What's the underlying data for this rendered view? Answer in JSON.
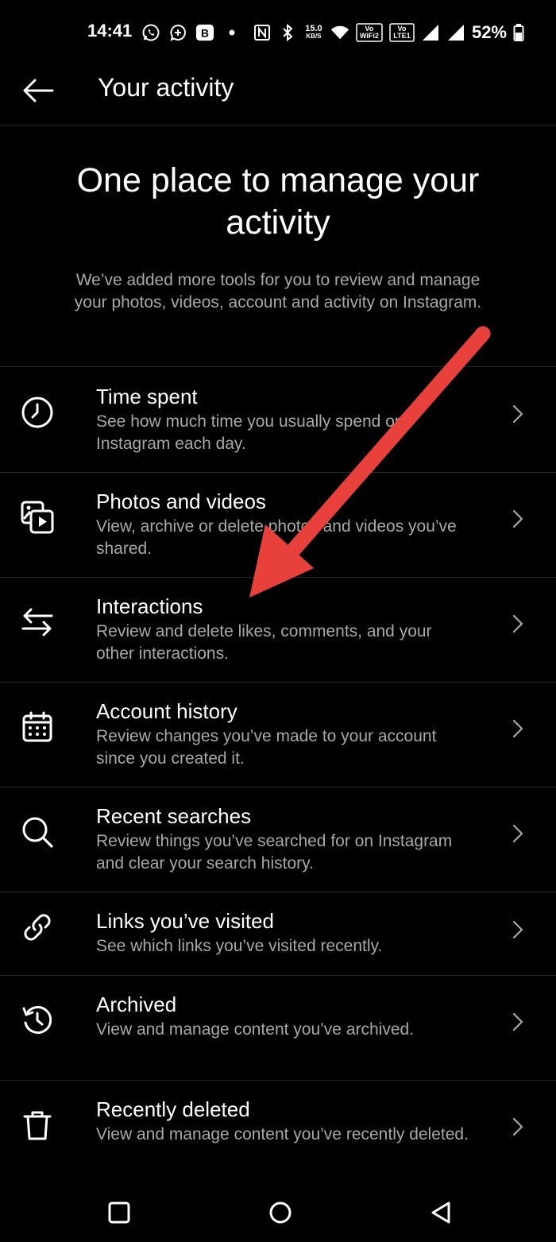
{
  "status_bar": {
    "time": "14:41",
    "speed_top": "15.0",
    "speed_unit": "KB/S",
    "sim1_top": "Vo",
    "sim1_bottom": "WiFi2",
    "sim2_top": "Vo",
    "sim2_bottom": "LTE1",
    "battery": "52%",
    "b_badge": "B",
    "icons": [
      "whatsapp-icon",
      "messenger-icon",
      "b-app-icon",
      "dot-icon",
      "nfc-icon",
      "bluetooth-icon",
      "wifi-icon",
      "signal-icon",
      "signal-icon",
      "battery-icon"
    ]
  },
  "header": {
    "title": "Your activity"
  },
  "intro": {
    "title": "One place to manage your activity",
    "description": "We’ve added more tools for you to review and manage your photos, videos, account and activity on Instagram."
  },
  "items": [
    {
      "icon": "clock-icon",
      "title": "Time spent",
      "desc": "See how much time you usually spend on Instagram each day."
    },
    {
      "icon": "photos-videos-icon",
      "title": "Photos and videos",
      "desc": "View, archive or delete photos and videos you’ve shared."
    },
    {
      "icon": "interactions-icon",
      "title": "Interactions",
      "desc": "Review and delete likes, comments, and your other interactions."
    },
    {
      "icon": "calendar-icon",
      "title": "Account history",
      "desc": "Review changes you’ve made to your account since you created it."
    },
    {
      "icon": "search-icon",
      "title": "Recent searches",
      "desc": "Review things you’ve searched for on Instagram and clear your search history."
    },
    {
      "icon": "link-icon",
      "title": "Links you’ve visited",
      "desc": "See which links you’ve visited recently."
    },
    {
      "icon": "archive-icon",
      "title": "Archived",
      "desc": "View and manage content you’ve archived."
    },
    {
      "icon": "trash-icon",
      "title": "Recently deleted",
      "desc": "View and manage content you’ve recently deleted."
    }
  ],
  "colors": {
    "background": "#000000",
    "text_primary": "#ffffff",
    "text_secondary": "#a8a8a8",
    "divider": "#262626",
    "annotation_arrow": "#e8403a"
  }
}
